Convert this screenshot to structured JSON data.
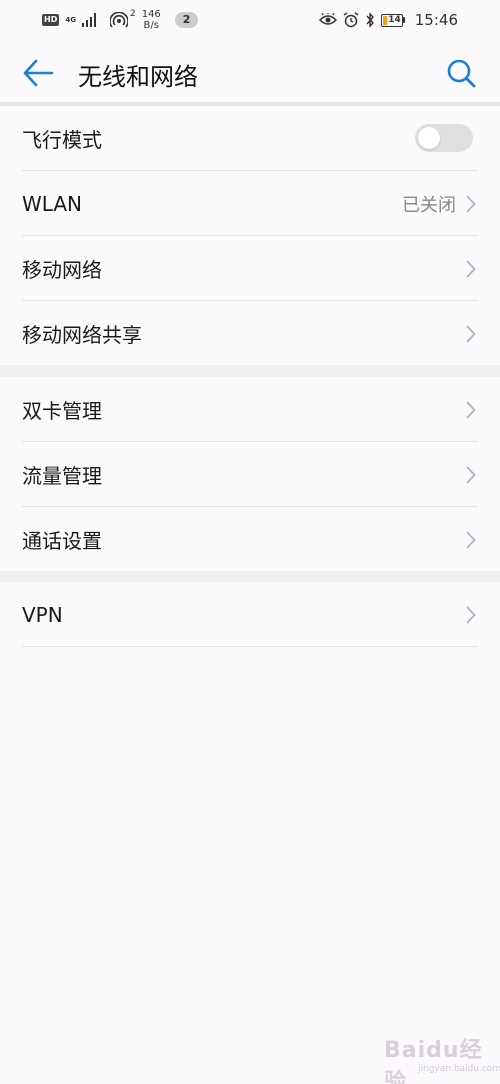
{
  "status_bar": {
    "hd": "HD",
    "net_type": "4G",
    "hotspot_count": "2",
    "speed_value": "146",
    "speed_unit": "B/s",
    "notification_count": "2",
    "battery_level": "14",
    "time": "15:46"
  },
  "header": {
    "title": "无线和网络"
  },
  "sections": [
    {
      "rows": [
        {
          "label": "飞行模式",
          "type": "toggle",
          "on": false
        },
        {
          "label": "WLAN",
          "type": "link",
          "value": "已关闭"
        },
        {
          "label": "移动网络",
          "type": "link"
        },
        {
          "label": "移动网络共享",
          "type": "link"
        }
      ]
    },
    {
      "rows": [
        {
          "label": "双卡管理",
          "type": "link"
        },
        {
          "label": "流量管理",
          "type": "link"
        },
        {
          "label": "通话设置",
          "type": "link"
        }
      ]
    },
    {
      "rows": [
        {
          "label": "VPN",
          "type": "link"
        }
      ]
    }
  ],
  "watermark": {
    "text": "Baidu经验",
    "sub": "jingyan.baidu.com"
  },
  "colors": {
    "accent": "#1a7fd9",
    "background": "#fbf9fc",
    "section_gap": "#f0eef1",
    "battery_low": "#f0a21b"
  }
}
